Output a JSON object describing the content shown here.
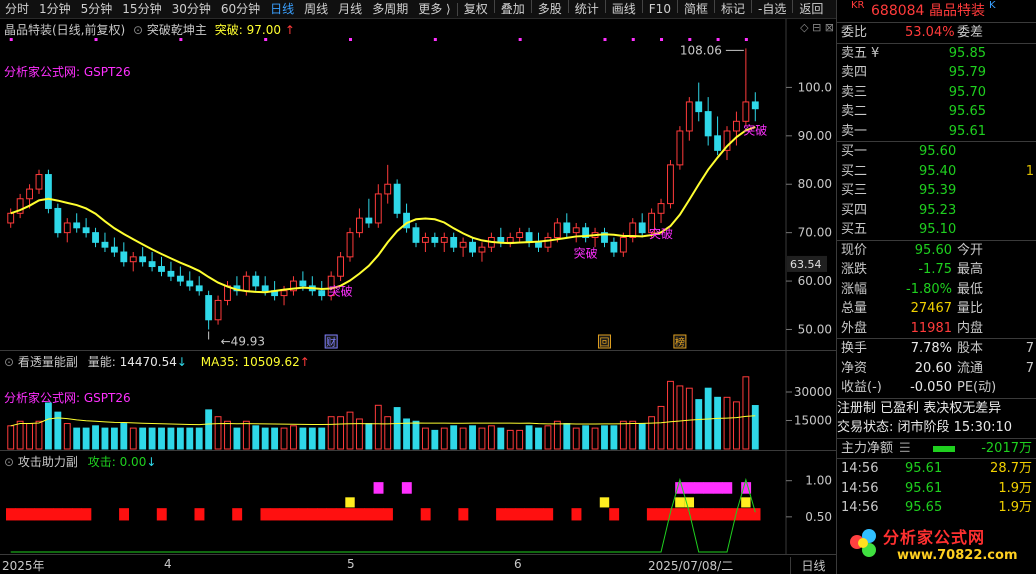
{
  "toolbar": {
    "periods": [
      "分时",
      "1分钟",
      "5分钟",
      "15分钟",
      "30分钟",
      "60分钟",
      "日线",
      "周线",
      "月线",
      "多周期",
      "更多 ⟩"
    ],
    "active_period": "日线",
    "tools": [
      "复权",
      "叠加",
      "多股",
      "统计",
      "画线",
      "F10",
      "简框",
      "标记",
      "-自选",
      "返回"
    ]
  },
  "main_pane": {
    "title": "晶品特装(日线,前复权)",
    "indicator": "突破乾坤主",
    "break_label": "突破:",
    "break_value": "97.00",
    "watermark": "分析家公式网: GSPT26",
    "max_label": "108.06",
    "min_label": "49.93",
    "signal_label": "突破",
    "current_price_tag": "63.54",
    "y_axis": [
      "100.0",
      "90.00",
      "80.00",
      "70.00",
      "60.00",
      "50.00"
    ],
    "markers": [
      "财",
      "回",
      "榜"
    ]
  },
  "volume_pane": {
    "title": "看透量能副",
    "label1": "量能:",
    "value1": "14470.54",
    "label2": "MA35:",
    "value2": "10509.62",
    "watermark": "分析家公式网: GSPT26",
    "y_axis": [
      "30000",
      "15000"
    ]
  },
  "attack_pane": {
    "title": "攻击助力副",
    "label": "攻击:",
    "value": "0.00",
    "y_axis": [
      "1.00",
      "0.50"
    ]
  },
  "x_axis": [
    "2025年",
    "4",
    "5",
    "6",
    "2025/07/08/二"
  ],
  "x_axis_right": "日线",
  "quote": {
    "market": "KR",
    "code": "688084",
    "name": "晶品特装",
    "badge": "K",
    "weibi_label": "委比",
    "weibi_value": "53.04%",
    "weicha_label": "委差",
    "asks": [
      {
        "label": "卖五",
        "mark": "¥",
        "price": "95.85",
        "vol": ""
      },
      {
        "label": "卖四",
        "mark": "",
        "price": "95.79",
        "vol": ""
      },
      {
        "label": "卖三",
        "mark": "",
        "price": "95.70",
        "vol": ""
      },
      {
        "label": "卖二",
        "mark": "",
        "price": "95.65",
        "vol": ""
      },
      {
        "label": "卖一",
        "mark": "",
        "price": "95.61",
        "vol": ""
      }
    ],
    "bids": [
      {
        "label": "买一",
        "price": "95.60",
        "vol": ""
      },
      {
        "label": "买二",
        "price": "95.40",
        "vol": "1"
      },
      {
        "label": "买三",
        "price": "95.39",
        "vol": ""
      },
      {
        "label": "买四",
        "price": "95.23",
        "vol": ""
      },
      {
        "label": "买五",
        "price": "95.10",
        "vol": ""
      }
    ],
    "stats": [
      {
        "l1": "现价",
        "v1": "95.60",
        "c1": "green",
        "l2": "今开",
        "v2": ""
      },
      {
        "l1": "涨跌",
        "v1": "-1.75",
        "c1": "green",
        "l2": "最高",
        "v2": ""
      },
      {
        "l1": "涨幅",
        "v1": "-1.80%",
        "c1": "green",
        "l2": "最低",
        "v2": ""
      },
      {
        "l1": "总量",
        "v1": "27467",
        "c1": "yellow",
        "l2": "量比",
        "v2": ""
      },
      {
        "l1": "外盘",
        "v1": "11981",
        "c1": "red",
        "l2": "内盘",
        "v2": ""
      }
    ],
    "stats2": [
      {
        "l1": "换手",
        "v1": "7.78%",
        "c1": "white",
        "l2": "股本",
        "v2": "7"
      },
      {
        "l1": "净资",
        "v1": "20.60",
        "c1": "white",
        "l2": "流通",
        "v2": "7"
      },
      {
        "l1": "收益(-)",
        "v1": "-0.050",
        "c1": "white",
        "l2": "PE(动)",
        "v2": ""
      }
    ],
    "info1": "注册制 已盈利 表决权无差异",
    "info2": "交易状态: 闭市阶段 15:30:10",
    "netflow_label": "主力净额",
    "netflow_value": "-2017万",
    "ticks": [
      {
        "time": "14:56",
        "price": "95.61",
        "vol": "28.7万"
      },
      {
        "time": "14:56",
        "price": "95.61",
        "vol": "1.9万"
      },
      {
        "time": "14:56",
        "price": "95.65",
        "vol": "1.9万"
      }
    ],
    "logo_text": "分析家公式网",
    "logo_url": "www.70822.com"
  },
  "colors": {
    "up": "#ff3b3b",
    "down": "#2fd8e8",
    "line": "#ffff30",
    "magenta": "#ff30ff",
    "green": "#1fd01f"
  },
  "chart_data": {
    "type": "candlestick",
    "overlay_line": "突破乾坤主",
    "candles": [
      [
        72,
        75,
        71,
        74
      ],
      [
        74,
        78,
        73,
        77
      ],
      [
        77,
        80,
        75,
        79
      ],
      [
        79,
        83,
        78,
        82
      ],
      [
        82,
        83,
        74,
        75
      ],
      [
        75,
        76,
        69,
        70
      ],
      [
        70,
        73,
        68,
        72
      ],
      [
        72,
        74,
        70,
        71
      ],
      [
        71,
        73,
        69,
        70
      ],
      [
        70,
        71,
        67,
        68
      ],
      [
        68,
        70,
        66,
        67
      ],
      [
        67,
        69,
        65,
        66
      ],
      [
        66,
        68,
        63,
        64
      ],
      [
        64,
        66,
        62,
        65
      ],
      [
        65,
        67,
        63,
        64
      ],
      [
        64,
        66,
        62,
        63
      ],
      [
        63,
        65,
        61,
        62
      ],
      [
        62,
        64,
        60,
        61
      ],
      [
        61,
        63,
        59,
        60
      ],
      [
        60,
        62,
        58,
        59
      ],
      [
        59,
        61,
        57,
        58
      ],
      [
        57,
        58,
        50,
        52
      ],
      [
        52,
        57,
        51,
        56
      ],
      [
        56,
        60,
        55,
        59
      ],
      [
        59,
        61,
        57,
        58
      ],
      [
        58,
        62,
        57,
        61
      ],
      [
        61,
        62,
        58,
        59
      ],
      [
        59,
        61,
        57,
        58
      ],
      [
        58,
        60,
        56,
        57
      ],
      [
        57,
        59,
        55,
        58
      ],
      [
        58,
        61,
        57,
        60
      ],
      [
        60,
        62,
        58,
        59
      ],
      [
        59,
        61,
        57,
        58
      ],
      [
        58,
        60,
        56,
        57
      ],
      [
        57,
        62,
        56,
        61
      ],
      [
        61,
        66,
        60,
        65
      ],
      [
        65,
        71,
        64,
        70
      ],
      [
        70,
        75,
        69,
        73
      ],
      [
        73,
        77,
        71,
        72
      ],
      [
        72,
        80,
        71,
        78
      ],
      [
        78,
        84,
        76,
        80
      ],
      [
        80,
        81,
        73,
        74
      ],
      [
        74,
        76,
        70,
        71
      ],
      [
        71,
        72,
        67,
        68
      ],
      [
        68,
        70,
        66,
        69
      ],
      [
        69,
        70,
        67,
        68
      ],
      [
        68,
        70,
        66,
        69
      ],
      [
        69,
        70,
        66,
        67
      ],
      [
        67,
        69,
        65,
        68
      ],
      [
        68,
        69,
        65,
        66
      ],
      [
        66,
        68,
        64,
        67
      ],
      [
        67,
        70,
        66,
        69
      ],
      [
        69,
        71,
        67,
        68
      ],
      [
        68,
        70,
        67,
        69
      ],
      [
        69,
        71,
        68,
        70
      ],
      [
        70,
        71,
        67,
        68
      ],
      [
        68,
        70,
        66,
        67
      ],
      [
        67,
        70,
        66,
        69
      ],
      [
        69,
        73,
        68,
        72
      ],
      [
        72,
        74,
        69,
        70
      ],
      [
        70,
        72,
        68,
        71
      ],
      [
        71,
        72,
        68,
        69
      ],
      [
        69,
        71,
        67,
        70
      ],
      [
        70,
        71,
        67,
        68
      ],
      [
        68,
        69,
        65,
        66
      ],
      [
        66,
        70,
        65,
        69
      ],
      [
        69,
        73,
        68,
        72
      ],
      [
        72,
        74,
        69,
        70
      ],
      [
        70,
        75,
        69,
        74
      ],
      [
        74,
        77,
        72,
        76
      ],
      [
        76,
        85,
        75,
        84
      ],
      [
        84,
        92,
        83,
        91
      ],
      [
        91,
        98,
        89,
        97
      ],
      [
        97,
        101,
        93,
        95
      ],
      [
        95,
        98,
        88,
        90
      ],
      [
        90,
        94,
        86,
        87
      ],
      [
        87,
        92,
        85,
        91
      ],
      [
        91,
        95,
        88,
        93
      ],
      [
        93,
        108.06,
        92,
        97
      ],
      [
        97,
        99,
        93,
        95.6
      ]
    ],
    "y_range": [
      47,
      110
    ],
    "volume_range": [
      0,
      40000
    ],
    "attack_range": [
      0,
      1.3
    ]
  }
}
